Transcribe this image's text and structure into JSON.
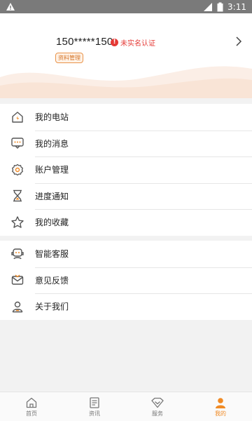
{
  "status_bar": {
    "time": "3:11"
  },
  "profile": {
    "phone": "150*****150",
    "verify_text": "未实名认证",
    "tag": "资料管理"
  },
  "menu_group_1": [
    {
      "label": "我的电站",
      "icon": "home-power-icon"
    },
    {
      "label": "我的消息",
      "icon": "message-icon"
    },
    {
      "label": "账户管理",
      "icon": "account-settings-icon"
    },
    {
      "label": "进度通知",
      "icon": "hourglass-icon"
    },
    {
      "label": "我的收藏",
      "icon": "star-icon"
    }
  ],
  "menu_group_2": [
    {
      "label": "智能客服",
      "icon": "customer-service-icon"
    },
    {
      "label": "意见反馈",
      "icon": "feedback-icon"
    },
    {
      "label": "关于我们",
      "icon": "about-icon"
    }
  ],
  "bottom_nav": [
    {
      "label": "首页",
      "icon": "home-icon",
      "active": false
    },
    {
      "label": "资讯",
      "icon": "news-icon",
      "active": false
    },
    {
      "label": "服务",
      "icon": "service-icon",
      "active": false
    },
    {
      "label": "我的",
      "icon": "user-icon",
      "active": true
    }
  ],
  "colors": {
    "accent": "#f08a24",
    "warning": "#e53935"
  }
}
